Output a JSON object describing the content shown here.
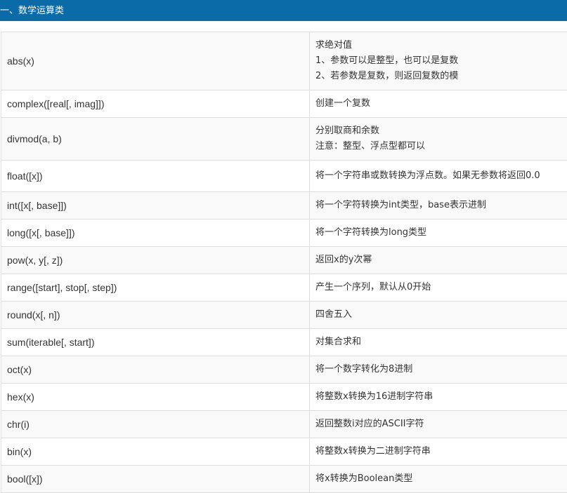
{
  "section_title": "一、数学运算类",
  "functions": [
    {
      "signature": "abs(x)",
      "description": [
        "求绝对值",
        "1、参数可以是整型，也可以是复数",
        "2、若参数是复数，则返回复数的模"
      ]
    },
    {
      "signature": "complex([real[, imag]])",
      "description": [
        "创建一个复数"
      ]
    },
    {
      "signature": "divmod(a, b)",
      "description": [
        "分别取商和余数",
        "注意：整型、浮点型都可以"
      ]
    },
    {
      "signature": "float([x])",
      "description": [
        "将一个字符串或数转换为浮点数。如果无参数将返回0.0"
      ]
    },
    {
      "signature": "int([x[, base]])",
      "description": [
        "将一个字符转换为int类型，base表示进制"
      ]
    },
    {
      "signature": "long([x[, base]])",
      "description": [
        "将一个字符转换为long类型"
      ]
    },
    {
      "signature": "pow(x, y[, z])",
      "description": [
        "返回x的y次幂"
      ]
    },
    {
      "signature": "range([start], stop[, step])",
      "description": [
        "产生一个序列，默认从0开始"
      ]
    },
    {
      "signature": "round(x[, n])",
      "description": [
        "四舍五入"
      ]
    },
    {
      "signature": "sum(iterable[, start])",
      "description": [
        "对集合求和"
      ]
    },
    {
      "signature": "oct(x)",
      "description": [
        "将一个数字转化为8进制"
      ]
    },
    {
      "signature": "hex(x)",
      "description": [
        "将整数x转换为16进制字符串"
      ]
    },
    {
      "signature": "chr(i)",
      "description": [
        "返回整数i对应的ASCII字符"
      ]
    },
    {
      "signature": "bin(x)",
      "description": [
        "将整数x转换为二进制字符串"
      ]
    },
    {
      "signature": "bool([x])",
      "description": [
        "将x转换为Boolean类型"
      ]
    }
  ]
}
